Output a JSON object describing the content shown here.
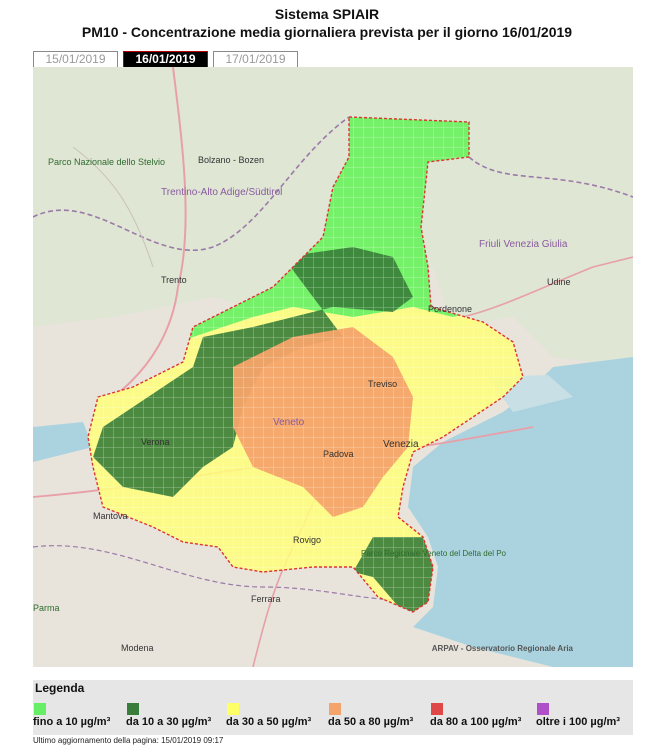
{
  "header": {
    "title": "Sistema SPIAIR",
    "subtitle": "PM10 - Concentrazione media giornaliera prevista per il giorno 16/01/2019"
  },
  "tabs": [
    {
      "label": "15/01/2019",
      "active": false
    },
    {
      "label": "16/01/2019",
      "active": true
    },
    {
      "label": "17/01/2019",
      "active": false
    }
  ],
  "map": {
    "credit": "ARPAV - Osservatorio Regionale Aria",
    "places": [
      "Parco Nazionale dello Stelvio",
      "Bolzano - Bozen",
      "Trentino-Alto Adige/Südtirol",
      "Friuli Venezia Giulia",
      "Udine",
      "Pordenone",
      "Trento",
      "Treviso",
      "Verona",
      "Veneto",
      "Padova",
      "Venezia",
      "Mantova",
      "Rovigo",
      "Parco Regionale Veneto del Delta del Po",
      "Ferrara",
      "Modena",
      "Parma"
    ]
  },
  "legend": {
    "title": "Legenda",
    "items": [
      {
        "label": "fino a 10 µg/m³",
        "color": "#66ee66"
      },
      {
        "label": "da 10 a 30 µg/m³",
        "color": "#3a7d3a"
      },
      {
        "label": "da 30 a 50 µg/m³",
        "color": "#ffff66"
      },
      {
        "label": "da 50 a 80 µg/m³",
        "color": "#f4a46a"
      },
      {
        "label": "da 80 a 100 µg/m³",
        "color": "#e04848"
      },
      {
        "label": "oltre i 100 µg/m³",
        "color": "#b050c8"
      }
    ]
  },
  "footer": {
    "updated": "Ultimo aggiornamento della pagina: 15/01/2019 09:17"
  }
}
